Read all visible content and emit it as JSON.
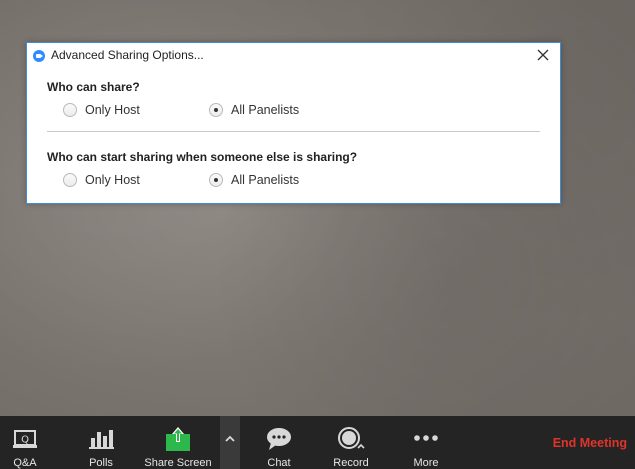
{
  "dialog": {
    "title": "Advanced Sharing Options...",
    "section1": {
      "question": "Who can share?",
      "options": [
        {
          "label": "Only Host",
          "selected": false
        },
        {
          "label": "All Panelists",
          "selected": true
        }
      ]
    },
    "section2": {
      "question": "Who can start sharing when someone else is sharing?",
      "options": [
        {
          "label": "Only Host",
          "selected": false
        },
        {
          "label": "All Panelists",
          "selected": true
        }
      ]
    }
  },
  "toolbar": {
    "items": [
      {
        "label": "Q&A",
        "icon": "qa-icon"
      },
      {
        "label": "Polls",
        "icon": "polls-icon"
      },
      {
        "label": "Share Screen",
        "icon": "share-screen-icon"
      },
      {
        "label": "Chat",
        "icon": "chat-icon"
      },
      {
        "label": "Record",
        "icon": "record-icon"
      },
      {
        "label": "More",
        "icon": "more-icon"
      }
    ],
    "end_meeting": "End Meeting"
  },
  "colors": {
    "accent": "#2d8cff",
    "share_green": "#2db84b",
    "end_red": "#e0342a",
    "toolbar_bg": "#242424"
  }
}
